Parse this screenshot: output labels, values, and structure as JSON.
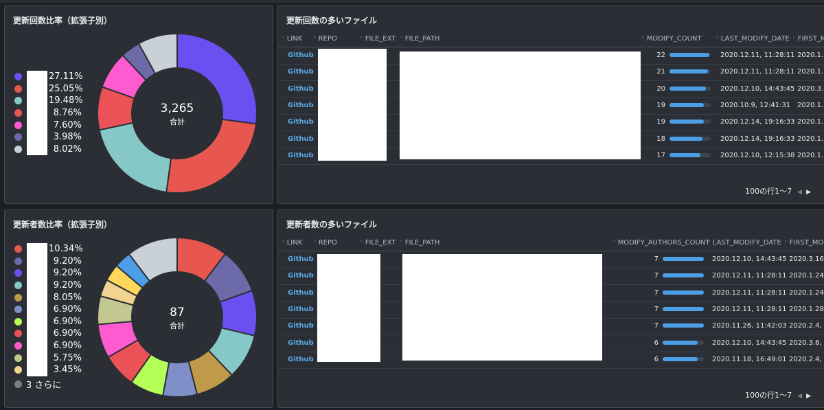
{
  "colors": {
    "panel_bg": "#2b2f35",
    "link": "#5aa9e6",
    "bar": "#4c9fe6"
  },
  "chart_data": [
    {
      "type": "pie",
      "title": "更新回数比率（拡張子別）",
      "total": "3,265",
      "total_label": "合計",
      "values": [
        27.11,
        25.05,
        19.48,
        8.76,
        7.6,
        3.98,
        8.02
      ],
      "labels": [
        "27.11%",
        "25.05%",
        "19.48%",
        "8.76%",
        "7.60%",
        "3.98%",
        "8.02%"
      ],
      "colors": [
        "#6b4ff0",
        "#e8574f",
        "#86c7c7",
        "#ea5257",
        "#ff5bd1",
        "#6c6aa8",
        "#c9d0d6"
      ],
      "more_label": ""
    },
    {
      "type": "pie",
      "title": "更新者数比率（拡張子別）",
      "total": "87",
      "total_label": "合計",
      "values": [
        10.34,
        9.2,
        9.2,
        9.2,
        8.05,
        6.9,
        6.9,
        6.9,
        6.9,
        5.75,
        3.45,
        3.45,
        3.45,
        10.35
      ],
      "labels": [
        "10.34%",
        "9.20%",
        "9.20%",
        "9.20%",
        "8.05%",
        "6.90%",
        "6.90%",
        "6.90%",
        "6.90%",
        "5.75%",
        "3.45%"
      ],
      "colors": [
        "#e8574f",
        "#6c6aa8",
        "#6b4ff0",
        "#86c7c7",
        "#c09a4a",
        "#7f90c8",
        "#b5ff59",
        "#ea5257",
        "#ff5bd1",
        "#c2c88f",
        "#f2d392",
        "#ffd75a",
        "#4c9fe6",
        "#c9d0d6"
      ],
      "more_label": "3 さらに"
    }
  ],
  "tables": [
    {
      "title": "更新回数の多いファイル",
      "headers": [
        "LINK",
        "REPO",
        "FILE_EXT",
        "FILE_PATH",
        "MODIFY_COUNT",
        "LAST_MODIFY_DATE",
        "FIRST_M"
      ],
      "max_count": 22,
      "rows": [
        {
          "link": "Github",
          "count": "22",
          "count_value": 22,
          "date": "2020.12.11, 11:28:11",
          "first": "2020.1."
        },
        {
          "link": "Github",
          "count": "21",
          "count_value": 21,
          "date": "2020.12.11, 11:28:11",
          "first": "2020.1."
        },
        {
          "link": "Github",
          "count": "20",
          "count_value": 20,
          "date": "2020.12.10, 14:43:45",
          "first": "2020.3."
        },
        {
          "link": "Github",
          "count": "19",
          "count_value": 19,
          "date": "2020.10.9, 12:41:31",
          "first": "2020.1."
        },
        {
          "link": "Github",
          "count": "19",
          "count_value": 19,
          "date": "2020.12.14, 19:16:33",
          "first": "2020.1."
        },
        {
          "link": "Github",
          "count": "18",
          "count_value": 18,
          "date": "2020.12.14, 19:16:33",
          "first": "2020.1."
        },
        {
          "link": "Github",
          "count": "17",
          "count_value": 17,
          "date": "2020.12.10, 12:15:38",
          "first": "2020.1."
        }
      ],
      "pager": "100の行1〜7"
    },
    {
      "title": "更新者数の多いファイル",
      "headers": [
        "LINK",
        "REPO",
        "FILE_EXT",
        "FILE_PATH",
        "MODIFY_AUTHORS_COUNT",
        "LAST_MODIFY_DATE",
        "FIRST_MO"
      ],
      "max_count": 7,
      "rows": [
        {
          "link": "Github",
          "count": "7",
          "count_value": 7,
          "date": "2020.12.10, 14:43:45",
          "first": "2020.3.16"
        },
        {
          "link": "Github",
          "count": "7",
          "count_value": 7,
          "date": "2020.12.11, 11:28:11",
          "first": "2020.1.24"
        },
        {
          "link": "Github",
          "count": "7",
          "count_value": 7,
          "date": "2020.12.11, 11:28:11",
          "first": "2020.1.24"
        },
        {
          "link": "Github",
          "count": "7",
          "count_value": 7,
          "date": "2020.12.11, 11:28:11",
          "first": "2020.1.28"
        },
        {
          "link": "Github",
          "count": "7",
          "count_value": 7,
          "date": "2020.11.26, 11:42:03",
          "first": "2020.2.4,"
        },
        {
          "link": "Github",
          "count": "6",
          "count_value": 6,
          "date": "2020.12.10, 14:43:45",
          "first": "2020.3.6,"
        },
        {
          "link": "Github",
          "count": "6",
          "count_value": 6,
          "date": "2020.11.18, 16:49:01",
          "first": "2020.2.4,"
        }
      ],
      "pager": "100の行1〜7"
    }
  ]
}
